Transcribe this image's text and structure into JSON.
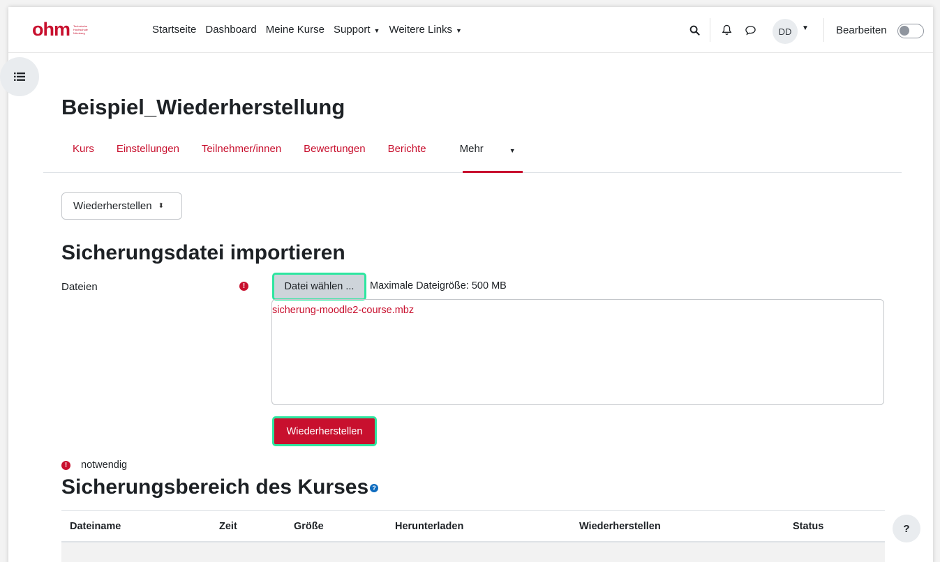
{
  "brand": {
    "logo_word": "ohm",
    "logo_sub": [
      "Technische",
      "Hochschule",
      "Nürnberg"
    ],
    "accent_color": "#c8102e",
    "highlight_color": "#2ee6a0"
  },
  "navbar": {
    "links": [
      {
        "label": "Startseite",
        "dropdown": false
      },
      {
        "label": "Dashboard",
        "dropdown": false
      },
      {
        "label": "Meine Kurse",
        "dropdown": false
      },
      {
        "label": "Support",
        "dropdown": true
      },
      {
        "label": "Weitere Links",
        "dropdown": true
      }
    ],
    "icons": [
      "search-icon",
      "bell-icon",
      "message-icon"
    ],
    "avatar_initials": "DD",
    "edit_label": "Bearbeiten",
    "edit_toggle_on": false
  },
  "page": {
    "title": "Beispiel_Wiederherstellung"
  },
  "secondary_nav": {
    "items": [
      "Kurs",
      "Einstellungen",
      "Teilnehmer/innen",
      "Bewertungen",
      "Berichte"
    ],
    "more_label": "Mehr",
    "active": "Mehr"
  },
  "action_select": {
    "value": "Wiederherstellen"
  },
  "import_section": {
    "heading": "Sicherungsdatei importieren",
    "field_label": "Dateien",
    "choose_button": "Datei wählen ...",
    "max_size": "Maximale Dateigröße: 500 MB",
    "selected_file": "sicherung-moodle2-course.mbz",
    "submit_button": "Wiederherstellen",
    "required_legend": "notwendig"
  },
  "backup_area": {
    "heading": "Sicherungsbereich des Kurses",
    "columns": [
      "Dateiname",
      "Zeit",
      "Größe",
      "Herunterladen",
      "Wiederherstellen",
      "Status"
    ]
  },
  "help_button": "?"
}
